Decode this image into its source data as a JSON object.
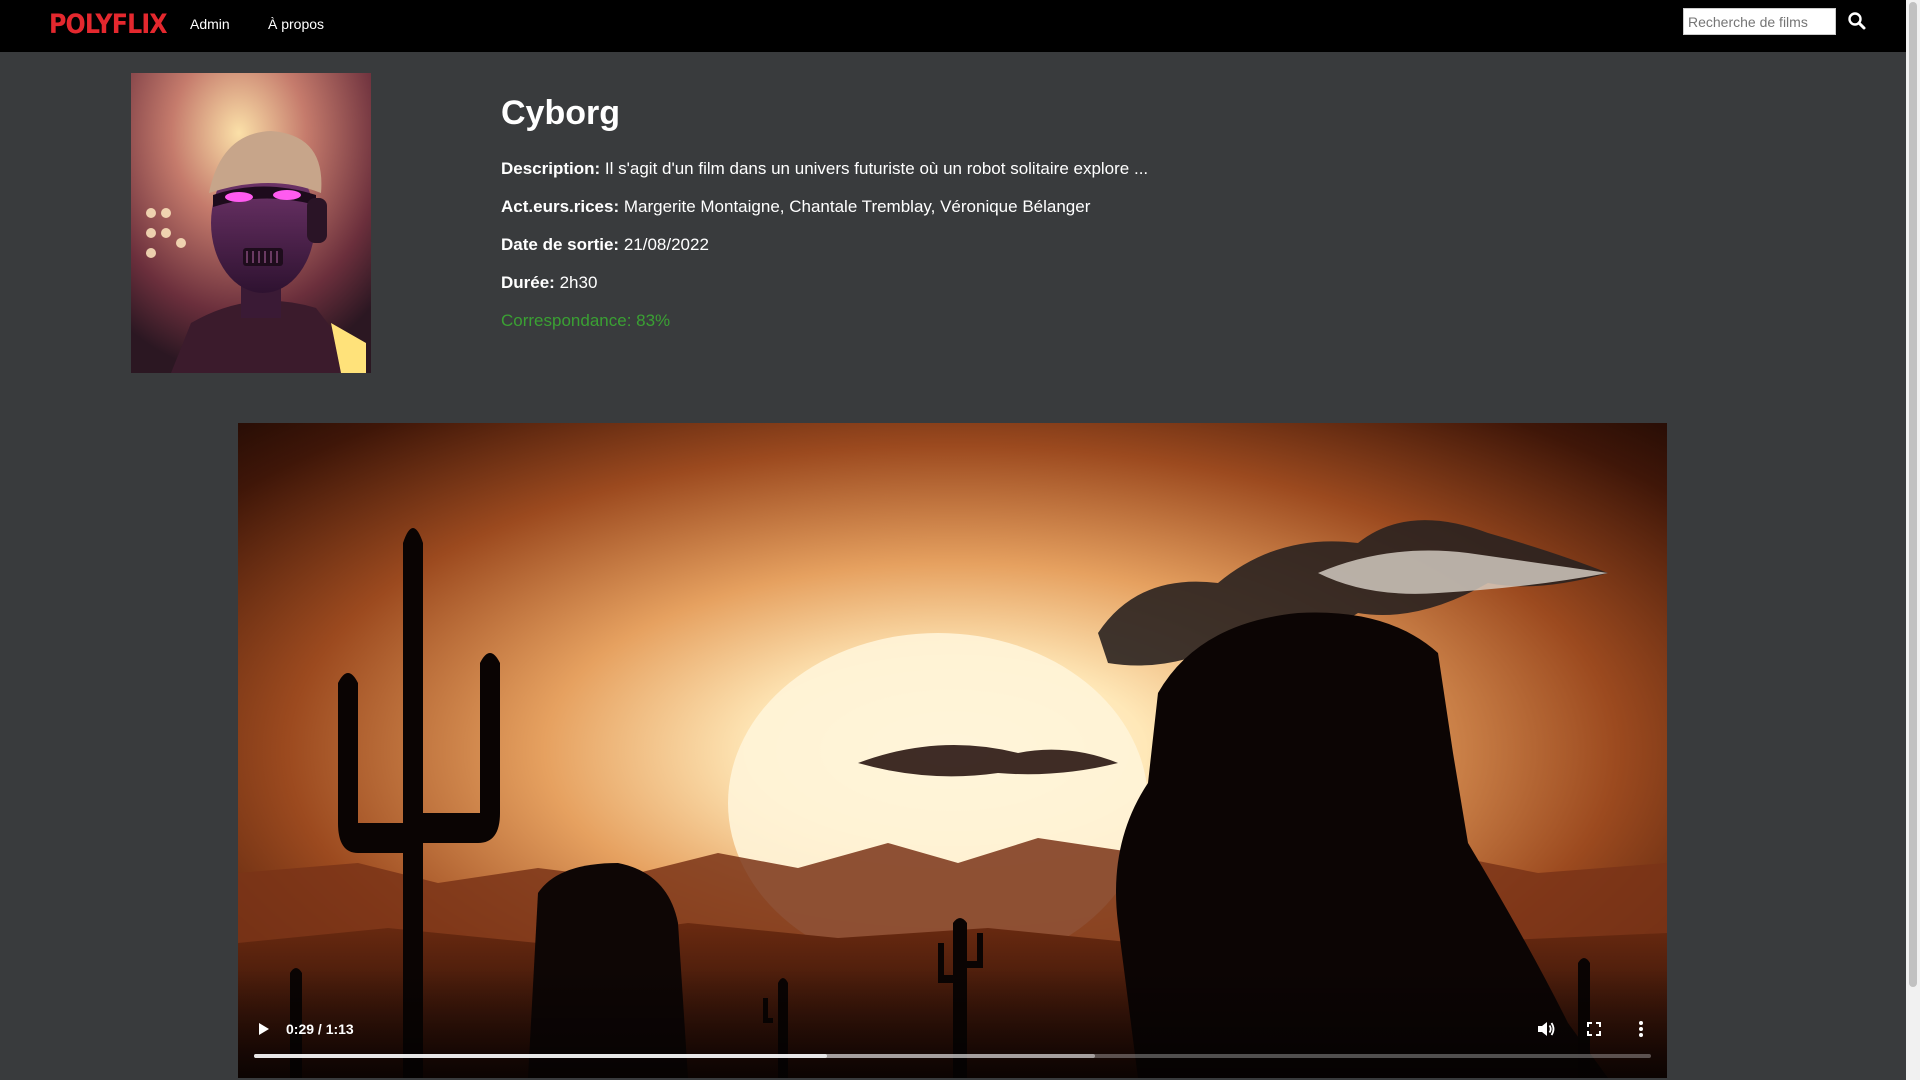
{
  "navbar": {
    "logo": "POLYFLIX",
    "links": [
      {
        "label": "Admin"
      },
      {
        "label": "À propos"
      }
    ],
    "search": {
      "placeholder": "Recherche de films",
      "value": ""
    },
    "search_icon": "search-icon"
  },
  "movie": {
    "title": "Cyborg",
    "description": {
      "label": "Description:",
      "value": "Il s'agit d'un film dans un univers futuriste où un robot solitaire explore ..."
    },
    "actors": {
      "label": "Act.eurs.rices:",
      "value": "Margerite Montaigne, Chantale Tremblay, Véronique Bélanger"
    },
    "release": {
      "label": "Date de sortie:",
      "value": "21/08/2022"
    },
    "duration": {
      "label": "Durée:",
      "value": "2h30"
    },
    "match": {
      "text": "Correspondance: 83%"
    },
    "poster_icon": "cyborg-poster-image"
  },
  "player": {
    "time": "0:29 / 1:13",
    "played_fraction": 0.41,
    "buffered_fraction": 0.602,
    "icons": {
      "play": "play-icon",
      "volume": "volume-icon",
      "fullscreen": "fullscreen-icon",
      "more": "more-vert-icon"
    }
  },
  "colors": {
    "brand": "#e4282e",
    "match": "#3aa033",
    "background": "#393b3d",
    "navbar": "#000000"
  }
}
